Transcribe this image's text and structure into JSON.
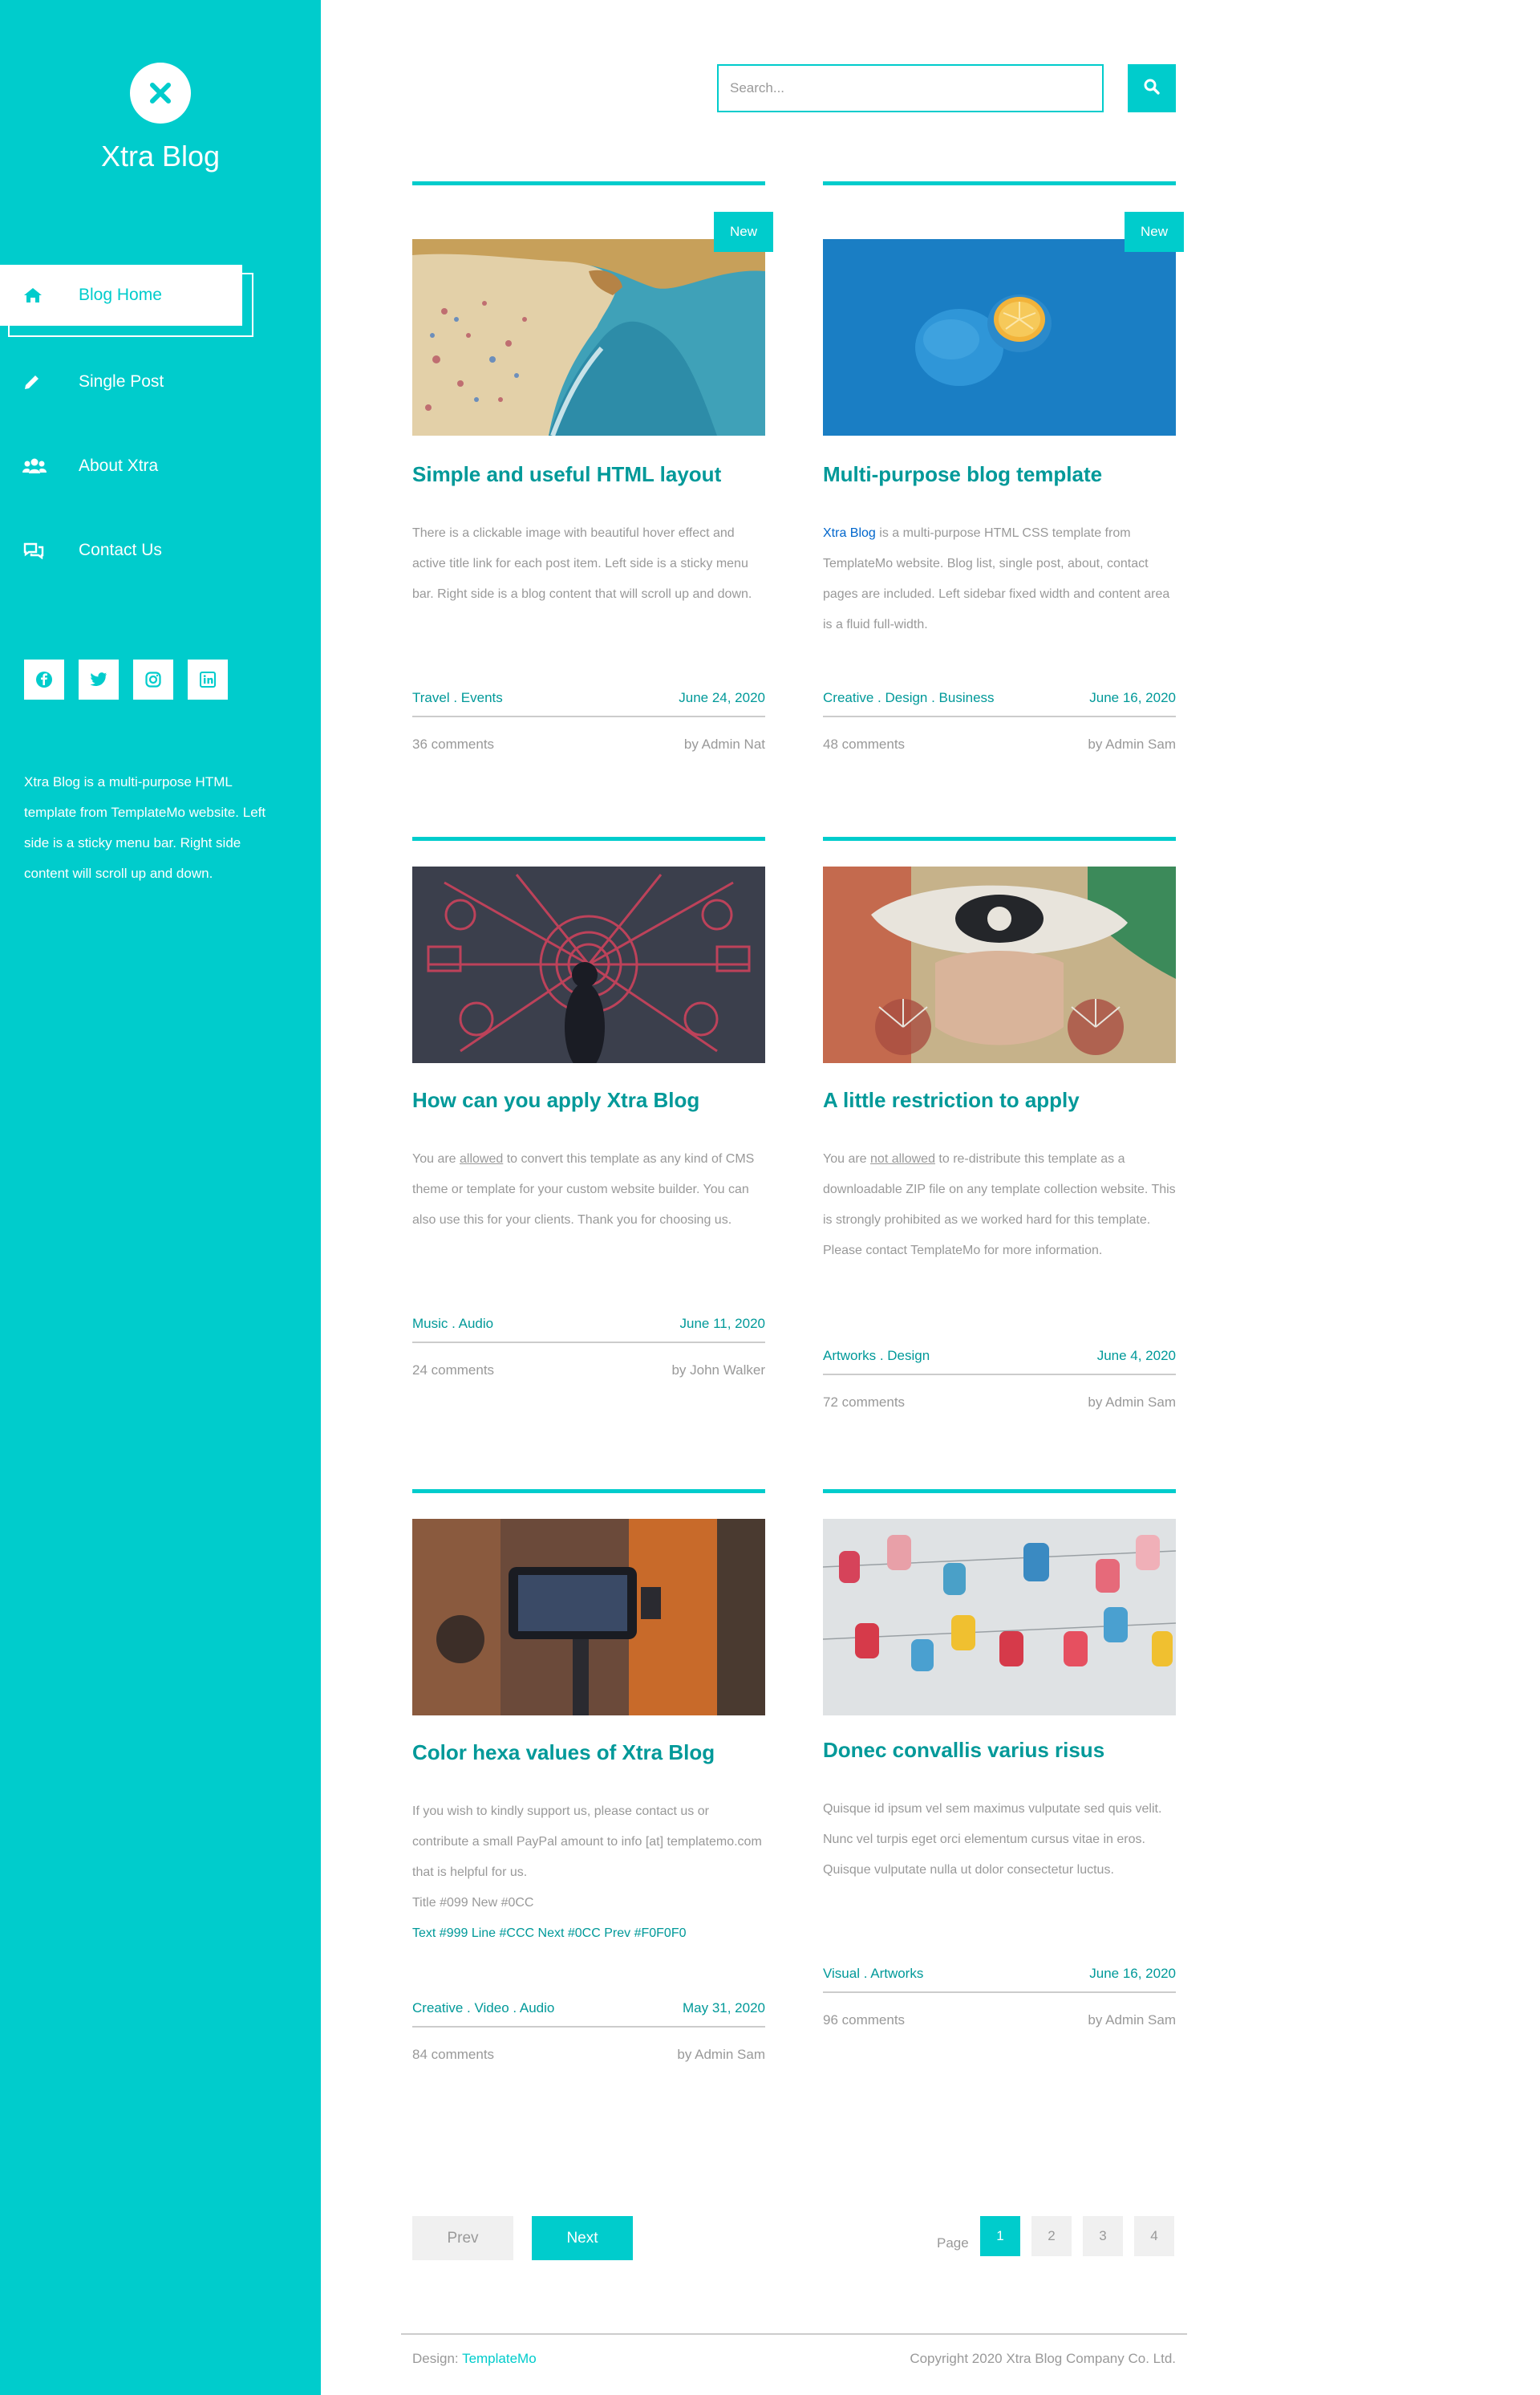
{
  "brand": {
    "title": "Xtra Blog",
    "accent": "#00CCCC",
    "title_color": "#009999",
    "link_color": "#0066CC"
  },
  "sidebar": {
    "nav": [
      {
        "label": "Blog Home",
        "icon": "home-icon",
        "active": true
      },
      {
        "label": "Single Post",
        "icon": "pen-icon",
        "active": false
      },
      {
        "label": "About Xtra",
        "icon": "users-icon",
        "active": false
      },
      {
        "label": "Contact Us",
        "icon": "comments-icon",
        "active": false
      }
    ],
    "social": [
      "facebook-icon",
      "twitter-icon",
      "instagram-icon",
      "linkedin-icon"
    ],
    "description": "Xtra Blog is a multi-purpose HTML template from TemplateMo website. Left side is a sticky menu bar. Right side content will scroll up and down."
  },
  "search": {
    "placeholder": "Search..."
  },
  "posts": [
    {
      "badge": "New",
      "title": "Simple and useful HTML layout",
      "excerpt": "There is a clickable image with beautiful hover effect and active title link for each post item. Left side is a sticky menu bar. Right side is a blog content that will scroll up and down.",
      "categories": "Travel . Events",
      "date": "June 24, 2020",
      "comments": "36 comments",
      "author": "by Admin Nat"
    },
    {
      "badge": "New",
      "title": "Multi-purpose blog template",
      "excerpt_link": "Xtra Blog",
      "excerpt": " is a multi-purpose HTML CSS template from TemplateMo website. Blog list, single post, about, contact pages are included. Left sidebar fixed width and content area is a fluid full-width.",
      "categories": "Creative . Design . Business",
      "date": "June 16, 2020",
      "comments": "48 comments",
      "author": "by Admin Sam"
    },
    {
      "title": "How can you apply Xtra Blog",
      "excerpt_pre": "You are ",
      "excerpt_u": "allowed",
      "excerpt": " to convert this template as any kind of CMS theme or template for your custom website builder. You can also use this for your clients. Thank you for choosing us.",
      "categories": "Music . Audio",
      "date": "June 11, 2020",
      "comments": "24 comments",
      "author": "by John Walker"
    },
    {
      "title": "A little restriction to apply",
      "excerpt_pre": "You are ",
      "excerpt_u": "not allowed",
      "excerpt": " to re-distribute this template as a downloadable ZIP file on any template collection website. This is strongly prohibited as we worked hard for this template. Please contact TemplateMo for more information.",
      "categories": "Artworks . Design",
      "date": "June 4, 2020",
      "comments": "72 comments",
      "author": "by Admin Sam"
    },
    {
      "title": "Color hexa values of Xtra Blog",
      "excerpt": "If you wish to kindly support us, please contact us or contribute a small PayPal amount to info [at] templatemo.com that is helpful for us.",
      "excerpt_line2": "Title #099 New #0CC",
      "excerpt_line3": "Text #999 Line #CCC Next #0CC Prev #F0F0F0",
      "categories": "Creative . Video . Audio",
      "date": "May 31, 2020",
      "comments": "84 comments",
      "author": "by Admin Sam"
    },
    {
      "title": "Donec convallis varius risus",
      "excerpt": "Quisque id ipsum vel sem maximus vulputate sed quis velit. Nunc vel turpis eget orci elementum cursus vitae in eros. Quisque vulputate nulla ut dolor consectetur luctus.",
      "categories": "Visual . Artworks",
      "date": "June 16, 2020",
      "comments": "96 comments",
      "author": "by Admin Sam"
    }
  ],
  "pagination": {
    "prev": "Prev",
    "next": "Next",
    "page_label": "Page",
    "pages": [
      "1",
      "2",
      "3",
      "4"
    ],
    "current": "1"
  },
  "footer": {
    "design_label": "Design: ",
    "design_link": "TemplateMo",
    "copyright": "Copyright 2020 Xtra Blog Company Co. Ltd."
  }
}
